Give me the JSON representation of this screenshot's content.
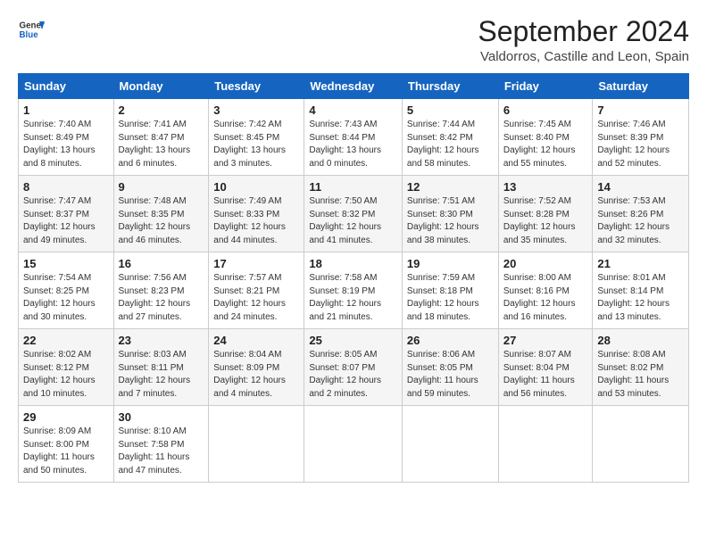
{
  "header": {
    "logo_line1": "General",
    "logo_line2": "Blue",
    "month": "September 2024",
    "location": "Valdorros, Castille and Leon, Spain"
  },
  "days_of_week": [
    "Sunday",
    "Monday",
    "Tuesday",
    "Wednesday",
    "Thursday",
    "Friday",
    "Saturday"
  ],
  "weeks": [
    [
      {
        "day": "1",
        "info": "Sunrise: 7:40 AM\nSunset: 8:49 PM\nDaylight: 13 hours\nand 8 minutes."
      },
      {
        "day": "2",
        "info": "Sunrise: 7:41 AM\nSunset: 8:47 PM\nDaylight: 13 hours\nand 6 minutes."
      },
      {
        "day": "3",
        "info": "Sunrise: 7:42 AM\nSunset: 8:45 PM\nDaylight: 13 hours\nand 3 minutes."
      },
      {
        "day": "4",
        "info": "Sunrise: 7:43 AM\nSunset: 8:44 PM\nDaylight: 13 hours\nand 0 minutes."
      },
      {
        "day": "5",
        "info": "Sunrise: 7:44 AM\nSunset: 8:42 PM\nDaylight: 12 hours\nand 58 minutes."
      },
      {
        "day": "6",
        "info": "Sunrise: 7:45 AM\nSunset: 8:40 PM\nDaylight: 12 hours\nand 55 minutes."
      },
      {
        "day": "7",
        "info": "Sunrise: 7:46 AM\nSunset: 8:39 PM\nDaylight: 12 hours\nand 52 minutes."
      }
    ],
    [
      {
        "day": "8",
        "info": "Sunrise: 7:47 AM\nSunset: 8:37 PM\nDaylight: 12 hours\nand 49 minutes."
      },
      {
        "day": "9",
        "info": "Sunrise: 7:48 AM\nSunset: 8:35 PM\nDaylight: 12 hours\nand 46 minutes."
      },
      {
        "day": "10",
        "info": "Sunrise: 7:49 AM\nSunset: 8:33 PM\nDaylight: 12 hours\nand 44 minutes."
      },
      {
        "day": "11",
        "info": "Sunrise: 7:50 AM\nSunset: 8:32 PM\nDaylight: 12 hours\nand 41 minutes."
      },
      {
        "day": "12",
        "info": "Sunrise: 7:51 AM\nSunset: 8:30 PM\nDaylight: 12 hours\nand 38 minutes."
      },
      {
        "day": "13",
        "info": "Sunrise: 7:52 AM\nSunset: 8:28 PM\nDaylight: 12 hours\nand 35 minutes."
      },
      {
        "day": "14",
        "info": "Sunrise: 7:53 AM\nSunset: 8:26 PM\nDaylight: 12 hours\nand 32 minutes."
      }
    ],
    [
      {
        "day": "15",
        "info": "Sunrise: 7:54 AM\nSunset: 8:25 PM\nDaylight: 12 hours\nand 30 minutes."
      },
      {
        "day": "16",
        "info": "Sunrise: 7:56 AM\nSunset: 8:23 PM\nDaylight: 12 hours\nand 27 minutes."
      },
      {
        "day": "17",
        "info": "Sunrise: 7:57 AM\nSunset: 8:21 PM\nDaylight: 12 hours\nand 24 minutes."
      },
      {
        "day": "18",
        "info": "Sunrise: 7:58 AM\nSunset: 8:19 PM\nDaylight: 12 hours\nand 21 minutes."
      },
      {
        "day": "19",
        "info": "Sunrise: 7:59 AM\nSunset: 8:18 PM\nDaylight: 12 hours\nand 18 minutes."
      },
      {
        "day": "20",
        "info": "Sunrise: 8:00 AM\nSunset: 8:16 PM\nDaylight: 12 hours\nand 16 minutes."
      },
      {
        "day": "21",
        "info": "Sunrise: 8:01 AM\nSunset: 8:14 PM\nDaylight: 12 hours\nand 13 minutes."
      }
    ],
    [
      {
        "day": "22",
        "info": "Sunrise: 8:02 AM\nSunset: 8:12 PM\nDaylight: 12 hours\nand 10 minutes."
      },
      {
        "day": "23",
        "info": "Sunrise: 8:03 AM\nSunset: 8:11 PM\nDaylight: 12 hours\nand 7 minutes."
      },
      {
        "day": "24",
        "info": "Sunrise: 8:04 AM\nSunset: 8:09 PM\nDaylight: 12 hours\nand 4 minutes."
      },
      {
        "day": "25",
        "info": "Sunrise: 8:05 AM\nSunset: 8:07 PM\nDaylight: 12 hours\nand 2 minutes."
      },
      {
        "day": "26",
        "info": "Sunrise: 8:06 AM\nSunset: 8:05 PM\nDaylight: 11 hours\nand 59 minutes."
      },
      {
        "day": "27",
        "info": "Sunrise: 8:07 AM\nSunset: 8:04 PM\nDaylight: 11 hours\nand 56 minutes."
      },
      {
        "day": "28",
        "info": "Sunrise: 8:08 AM\nSunset: 8:02 PM\nDaylight: 11 hours\nand 53 minutes."
      }
    ],
    [
      {
        "day": "29",
        "info": "Sunrise: 8:09 AM\nSunset: 8:00 PM\nDaylight: 11 hours\nand 50 minutes."
      },
      {
        "day": "30",
        "info": "Sunrise: 8:10 AM\nSunset: 7:58 PM\nDaylight: 11 hours\nand 47 minutes."
      },
      {
        "day": "",
        "info": ""
      },
      {
        "day": "",
        "info": ""
      },
      {
        "day": "",
        "info": ""
      },
      {
        "day": "",
        "info": ""
      },
      {
        "day": "",
        "info": ""
      }
    ]
  ]
}
